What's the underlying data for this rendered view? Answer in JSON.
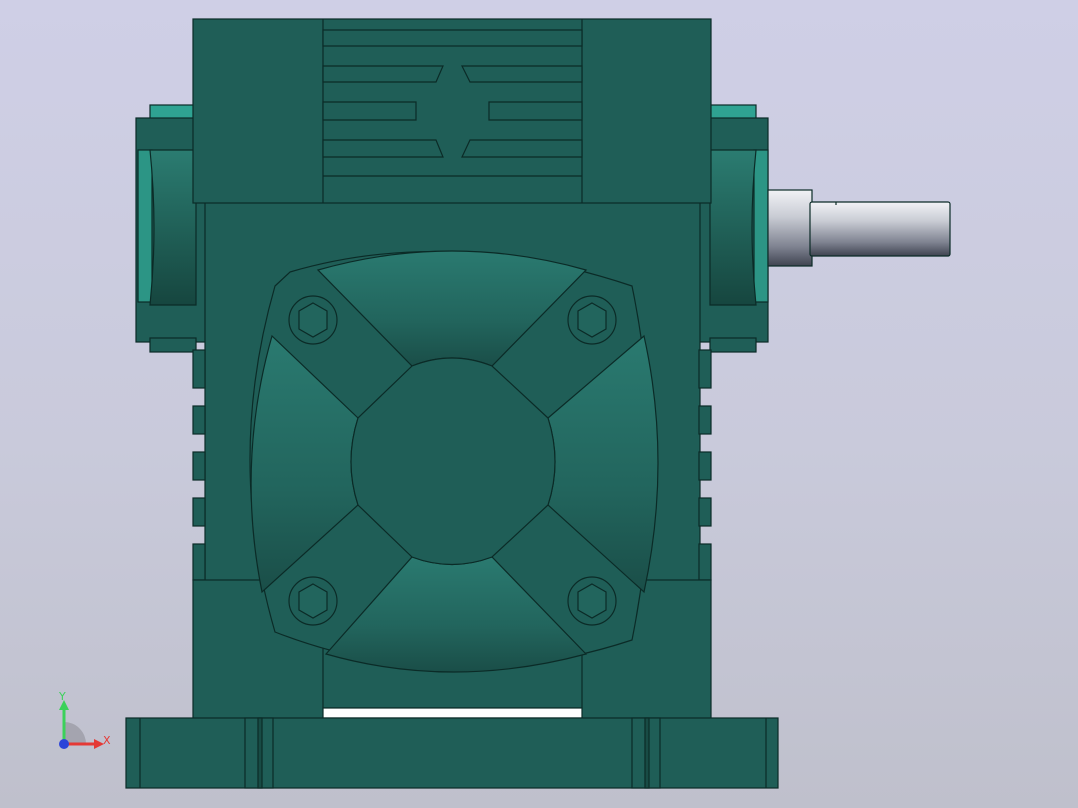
{
  "colors": {
    "background_top": "#cfcfe6",
    "background_bottom": "#bfc0cc",
    "body_main": "#1f5e57",
    "body_highlight": "#2f9e8d",
    "outline": "#0b2b27",
    "shaft_steel": "#b8bcc6",
    "axis_x": "#e53935",
    "axis_y": "#3bd15a",
    "axis_z": "#2b44d9"
  },
  "model": {
    "part": "worm-gear-reducer",
    "view": "front"
  },
  "triad": {
    "x_label": "X",
    "y_label": "Y"
  }
}
